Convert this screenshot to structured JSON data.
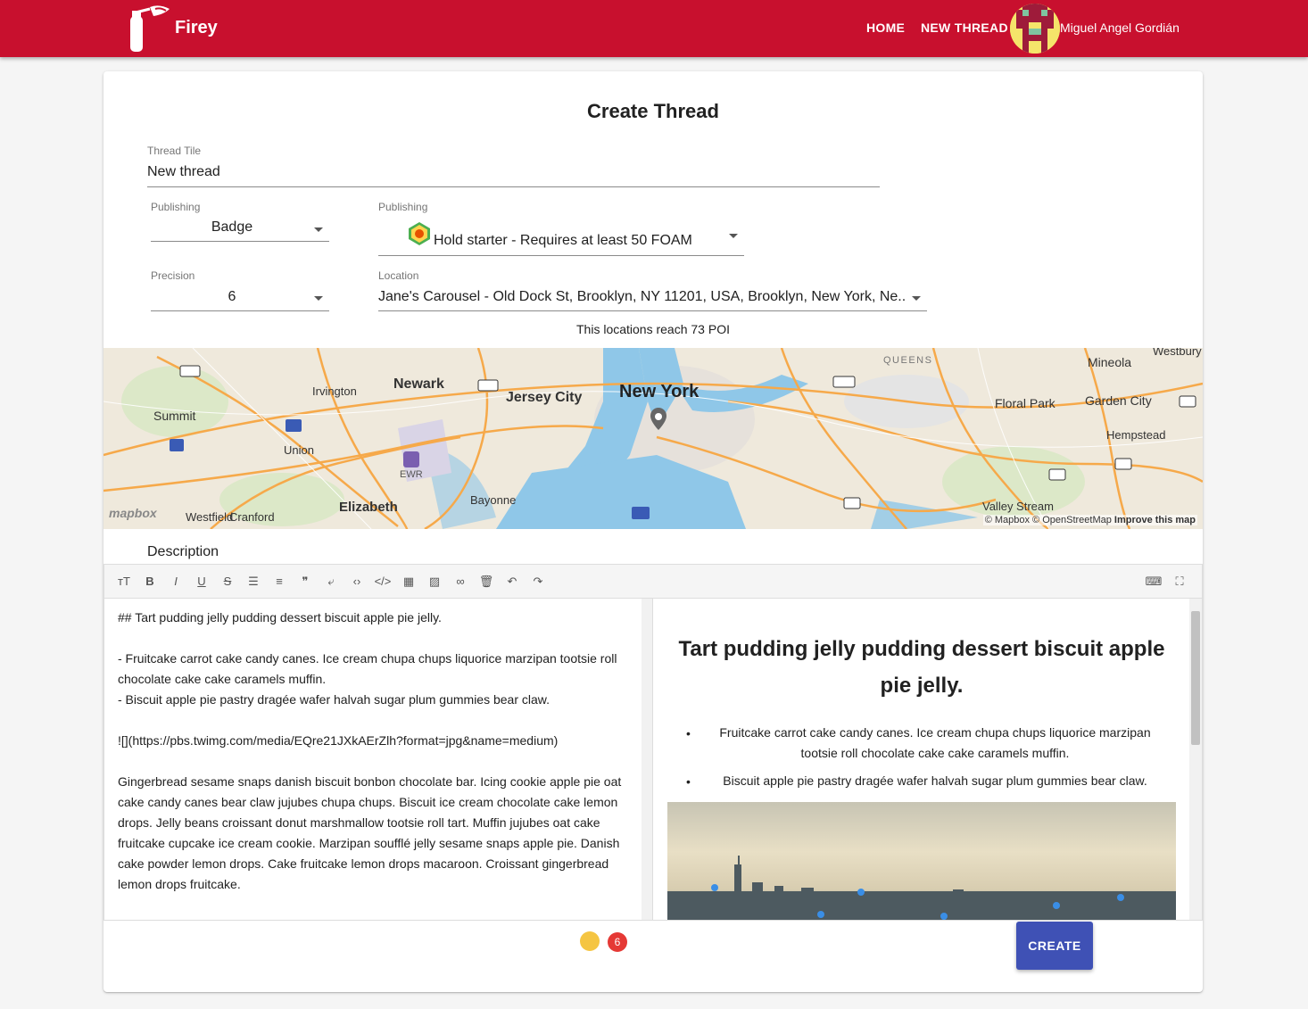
{
  "app": {
    "brand": "Firey",
    "nav": {
      "home": "HOME",
      "new_thread": "NEW THREAD"
    },
    "user": {
      "name": "Miguel Angel Gordián"
    },
    "colors": {
      "appbar": "#c8102e",
      "primary": "#3f51b5"
    }
  },
  "form": {
    "title": "Create Thread",
    "thread_title": {
      "label": "Thread Tile",
      "value": "New thread"
    },
    "publishing_type": {
      "label": "Publishing",
      "value": "Badge"
    },
    "publishing_badge": {
      "label": "Publishing",
      "value": "Hold starter - Requires at least 50 FOAM",
      "icon": "badge-icon"
    },
    "precision": {
      "label": "Precision",
      "value": "6"
    },
    "location": {
      "label": "Location",
      "value": "Jane's Carousel - Old Dock St, Brooklyn, NY 11201, USA, Brooklyn, New York, Ne..."
    },
    "reach_text": "This locations reach 73 POI",
    "description_label": "Description",
    "create_button": "CREATE"
  },
  "map": {
    "labels": {
      "newyork": "New York",
      "newark": "Newark",
      "jerseycity": "Jersey City",
      "irvington": "Irvington",
      "summit": "Summit",
      "union": "Union",
      "elizabeth": "Elizabeth",
      "bayonne": "Bayonne",
      "westfield": "Westfield",
      "cranford": "Cranford",
      "queens": "QUEENS",
      "mineola": "Mineola",
      "floralpark": "Floral Park",
      "gardencity": "Garden City",
      "hempstead": "Hempstead",
      "valleystream": "Valley Stream",
      "westbury": "Westbury",
      "ewr": "EWR"
    },
    "attribution": "© Mapbox © OpenStreetMap",
    "improve": "Improve this map",
    "logo": "mapbox"
  },
  "editor": {
    "markdown_lines": [
      "## Tart pudding jelly pudding dessert biscuit apple pie jelly.",
      "",
      "- Fruitcake carrot cake candy canes. Ice cream chupa chups liquorice marzipan tootsie roll",
      "chocolate cake cake caramels muffin.",
      "- Biscuit apple pie pastry dragée wafer halvah sugar plum gummies bear claw.",
      "",
      "![](https://pbs.twimg.com/media/EQre21JXkAErZlh?format=jpg&name=medium)",
      "",
      "Gingerbread sesame snaps danish biscuit bonbon chocolate bar. Icing cookie apple pie oat",
      "cake candy canes bear claw jujubes chupa chups. Biscuit ice cream chocolate cake lemon",
      "drops. Jelly beans croissant donut marshmallow tootsie roll tart. Muffin jujubes oat cake",
      "fruitcake cupcake ice cream cookie. Marzipan soufflé jelly sesame snaps apple pie. Danish",
      "cake powder lemon drops. Cake fruitcake lemon drops macaroon. Croissant gingerbread",
      "lemon drops fruitcake."
    ],
    "preview": {
      "heading": "Tart pudding jelly pudding dessert biscuit apple pie jelly.",
      "bullets": [
        "Fruitcake carrot cake candy canes. Ice cream chupa chups liquorice marzipan tootsie roll chocolate cake cake caramels muffin.",
        "Biscuit apple pie pastry dragée wafer halvah sugar plum gummies bear claw."
      ]
    },
    "badge_count": "6",
    "toolbar": [
      {
        "name": "heading-icon",
        "glyph": "ᴛT"
      },
      {
        "name": "bold-icon",
        "glyph": "B"
      },
      {
        "name": "italic-icon",
        "glyph": "I"
      },
      {
        "name": "underline-icon",
        "glyph": "U"
      },
      {
        "name": "strikethrough-icon",
        "glyph": "S"
      },
      {
        "name": "bullet-list-icon",
        "glyph": "☰"
      },
      {
        "name": "ordered-list-icon",
        "glyph": "≡"
      },
      {
        "name": "quote-icon",
        "glyph": "❞"
      },
      {
        "name": "wrap-icon",
        "glyph": "⤶"
      },
      {
        "name": "code-icon",
        "glyph": "‹›"
      },
      {
        "name": "code-block-icon",
        "glyph": "</>"
      },
      {
        "name": "table-icon",
        "glyph": "▦"
      },
      {
        "name": "image-icon",
        "glyph": "▨"
      },
      {
        "name": "link-icon",
        "glyph": "∞"
      },
      {
        "name": "trash-icon",
        "glyph": "🗑"
      },
      {
        "name": "undo-icon",
        "glyph": "↶"
      },
      {
        "name": "redo-icon",
        "glyph": "↷"
      }
    ]
  }
}
